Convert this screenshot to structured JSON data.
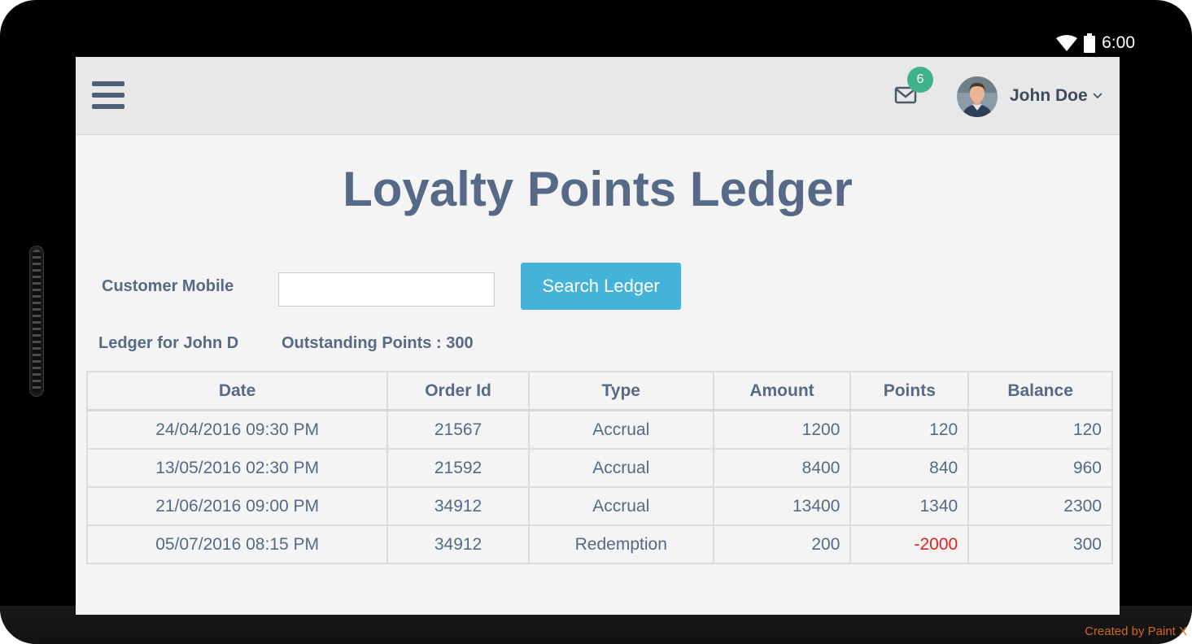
{
  "status_bar": {
    "time": "6:00"
  },
  "header": {
    "notification_count": "6",
    "user_name": "John Doe"
  },
  "page": {
    "title": "Loyalty Points Ledger"
  },
  "search": {
    "label": "Customer Mobile",
    "value": "",
    "button_label": "Search Ledger"
  },
  "summary": {
    "ledger_for": "Ledger for John D",
    "outstanding": "Outstanding Points : 300"
  },
  "table": {
    "headers": [
      "Date",
      "Order Id",
      "Type",
      "Amount",
      "Points",
      "Balance"
    ],
    "rows": [
      [
        "24/04/2016 09:30 PM",
        "21567",
        "Accrual",
        "1200",
        "120",
        "120"
      ],
      [
        "13/05/2016 02:30 PM",
        "21592",
        "Accrual",
        "8400",
        "840",
        "960"
      ],
      [
        "21/06/2016 09:00 PM",
        "34912",
        "Accrual",
        "13400",
        "1340",
        "2300"
      ],
      [
        "05/07/2016 08:15 PM",
        "34912",
        "Redemption",
        "200",
        "-2000",
        "300"
      ]
    ]
  },
  "footer": {
    "credit": "Created by Paint X"
  },
  "colors": {
    "accent": "#45b3d9",
    "badge": "#3fb28b",
    "text": "#566a87",
    "negative": "#e2231a"
  },
  "icons": [
    "menu-icon",
    "mail-icon",
    "chevron-down-icon",
    "wifi-icon",
    "battery-icon"
  ]
}
